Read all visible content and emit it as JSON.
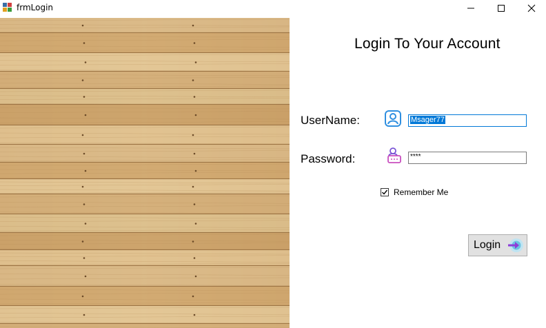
{
  "window": {
    "title": "frmLogin"
  },
  "form": {
    "heading": "Login To Your Account",
    "username_label": "UserName:",
    "username_value": "Msager77",
    "password_label": "Password:",
    "password_value": "****",
    "remember_label": "Remember Me",
    "remember_checked": true,
    "login_label": "Login"
  },
  "icons": {
    "username": "user-profile-icon",
    "password": "user-lock-icon",
    "login": "arrow-right-circle-icon"
  },
  "colors": {
    "selection": "#0078d7",
    "wood_base": "#d8b680",
    "login_arrow": "#8e3cd8"
  }
}
